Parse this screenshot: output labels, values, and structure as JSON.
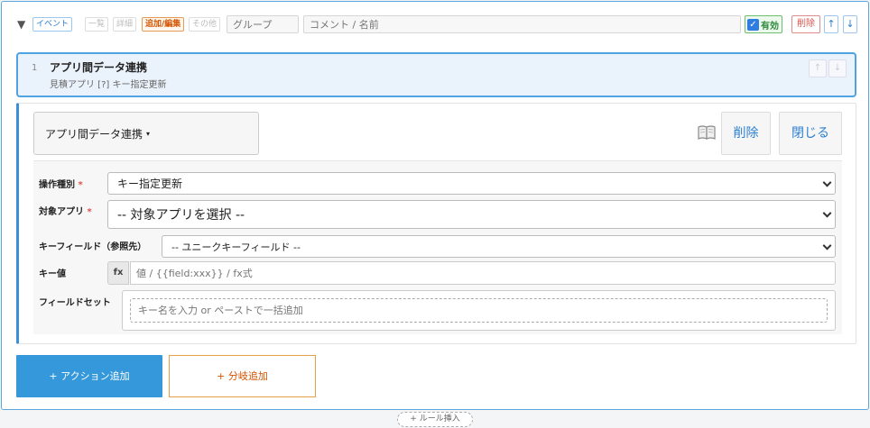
{
  "header": {
    "collapse_icon": "▼",
    "tags": [
      "イベント",
      "一覧",
      "詳細",
      "追加/編集",
      "その他"
    ],
    "group_placeholder": "グループ",
    "comment_placeholder": "コメント / 名前",
    "enabled_label": "有効",
    "delete_label": "削除",
    "up_label": "↑",
    "down_label": "↓"
  },
  "action_summary": {
    "index": "1",
    "title": "アプリ間データ連携",
    "subtitle": "見積アプリ [?] キー指定更新",
    "up_label": "↑",
    "down_label": "↓"
  },
  "editor": {
    "type_label": "アプリ間データ連携",
    "caret": "▾",
    "help_icon": "book-icon",
    "delete_label": "削除",
    "close_label": "閉じる"
  },
  "form": {
    "operation_label": "操作種別",
    "operation_value": "キー指定更新",
    "target_label": "対象アプリ",
    "target_value": "-- 対象アプリを選択 --",
    "keyfield_label": "キーフィールド（参照先）",
    "keyfield_value": "-- ユニークキーフィールド --",
    "keyvalue_label": "キー値",
    "fx_label": "fx",
    "keyvalue_placeholder": "値 / {{field:xxx}} / fx式",
    "fieldset_label": "フィールドセット",
    "fieldset_placeholder": "キー名を入力 or ペーストで一括追加",
    "required_mark": "*"
  },
  "footer": {
    "add_action_label": "+ アクション追加",
    "add_branch_label": "+ 分岐追加",
    "insert_rule_label": "+ ルール挿入"
  },
  "colors": {
    "accent": "#3498db",
    "branch": "#d35400",
    "danger": "#d9534f",
    "success": "#2e8b3d"
  }
}
